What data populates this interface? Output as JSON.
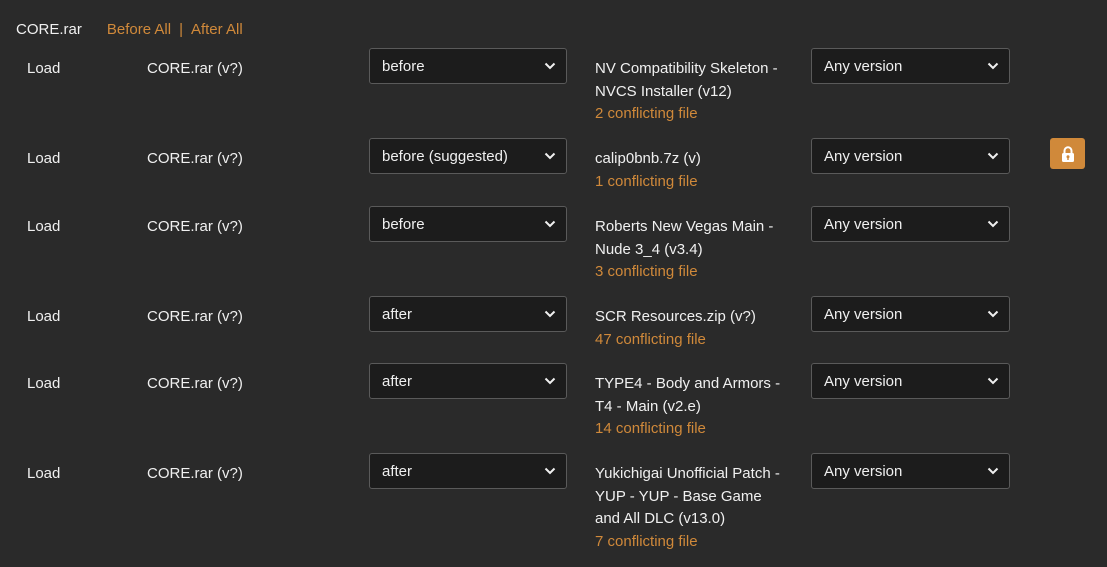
{
  "header": {
    "file_name": "CORE.rar",
    "before_all": "Before All",
    "separator": "|",
    "after_all": "After All"
  },
  "rows": [
    {
      "action": "Load",
      "source": "CORE.rar (v?)",
      "order": "before",
      "target": "NV Compatibility Skeleton - NVCS Installer (v12)",
      "conflicts": "2 conflicting file",
      "version": "Any version",
      "locked": false
    },
    {
      "action": "Load",
      "source": "CORE.rar (v?)",
      "order": "before (suggested)",
      "target": "calip0bnb.7z (v)",
      "conflicts": "1 conflicting file",
      "version": "Any version",
      "locked": true
    },
    {
      "action": "Load",
      "source": "CORE.rar (v?)",
      "order": "before",
      "target": "Roberts New Vegas Main - Nude 3_4 (v3.4)",
      "conflicts": "3 conflicting file",
      "version": "Any version",
      "locked": false
    },
    {
      "action": "Load",
      "source": "CORE.rar (v?)",
      "order": "after",
      "target": "SCR Resources.zip (v?)",
      "conflicts": "47 conflicting file",
      "version": "Any version",
      "locked": false
    },
    {
      "action": "Load",
      "source": "CORE.rar (v?)",
      "order": "after",
      "target": "TYPE4 - Body and Armors - T4 - Main (v2.e)",
      "conflicts": "14 conflicting file",
      "version": "Any version",
      "locked": false
    },
    {
      "action": "Load",
      "source": "CORE.rar (v?)",
      "order": "after",
      "target": "Yukichigai Unofficial Patch - YUP - YUP - Base Game and All DLC (v13.0)",
      "conflicts": "7 conflicting file",
      "version": "Any version",
      "locked": false
    }
  ],
  "icons": {
    "dropdown": "chevron-down-icon",
    "lock": "lock-icon"
  },
  "colors": {
    "background": "#2a2a2a",
    "accent": "#d0893a",
    "select_bg": "#1c1c1c"
  }
}
